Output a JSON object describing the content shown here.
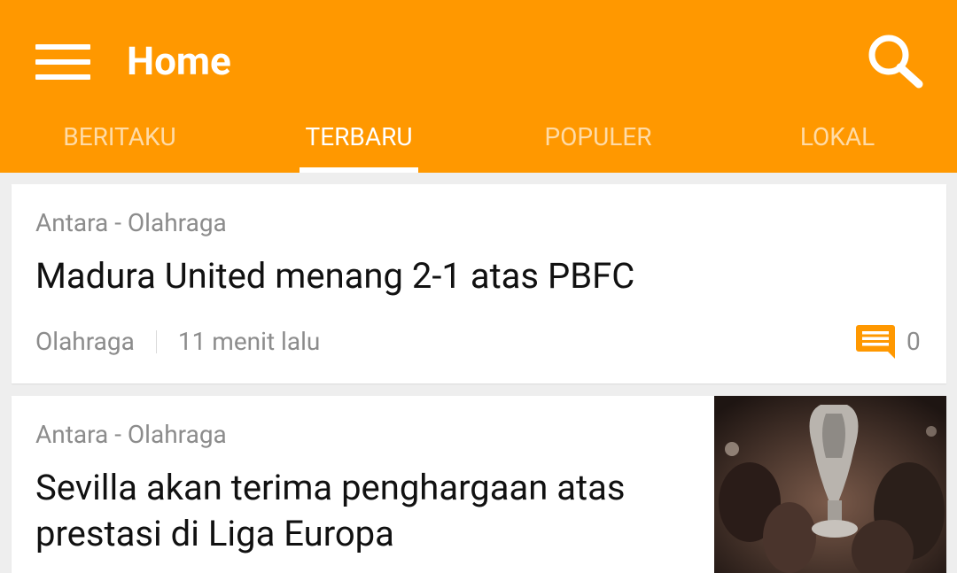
{
  "appbar": {
    "title": "Home",
    "bg_color": "#FF9800",
    "menu_icon": "menu-icon",
    "search_icon": "search-icon"
  },
  "tabs": [
    {
      "label": "BERITAKU",
      "active": false
    },
    {
      "label": "TERBARU",
      "active": true
    },
    {
      "label": "POPULER",
      "active": false
    },
    {
      "label": "LOKAL",
      "active": false
    }
  ],
  "articles": [
    {
      "source": "Antara - Olahraga",
      "title": "Madura United menang 2-1 atas PBFC",
      "category": "Olahraga",
      "time": "11 menit lalu",
      "comments": "0",
      "comment_icon": "comment-icon",
      "comment_icon_color": "#FF9800"
    },
    {
      "source": "Antara - Olahraga",
      "title": "Sevilla akan terima penghargaan atas prestasi di Liga Europa",
      "thumbnail_icon": "trophy-celebration-photo"
    }
  ]
}
